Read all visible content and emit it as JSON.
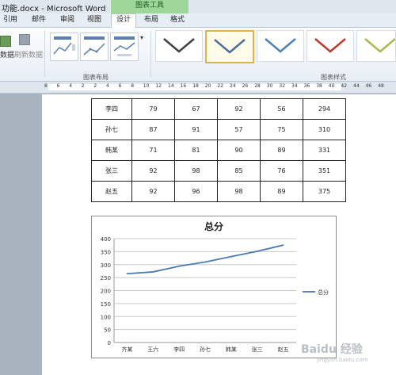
{
  "window": {
    "title": "功能.docx - Microsoft Word",
    "contextual_tools": "图表工具"
  },
  "tabs": [
    {
      "label": "引用"
    },
    {
      "label": "邮件"
    },
    {
      "label": "审阅"
    },
    {
      "label": "视图"
    },
    {
      "label": "设计",
      "active": true
    },
    {
      "label": "布局"
    },
    {
      "label": "格式"
    }
  ],
  "ribbon": {
    "data_label": "数据",
    "refresh_label": "刷新数据",
    "layout_group_label": "图表布局",
    "style_group_label": "图表样式",
    "style_colors": [
      "#404040",
      "#4b6f9c",
      "#4b82b8",
      "#c0392b",
      "#a9b84a"
    ]
  },
  "ruler": {
    "ticks": [
      "8",
      "6",
      "4",
      "2",
      "2",
      "4",
      "6",
      "8",
      "10",
      "12",
      "14",
      "16",
      "18",
      "20",
      "22",
      "24",
      "26",
      "28",
      "30",
      "32",
      "34",
      "36",
      "38",
      "40",
      "42",
      "44",
      "46",
      "48"
    ]
  },
  "table": {
    "rows": [
      {
        "name": "李四",
        "scores": [
          "79",
          "67",
          "92",
          "56",
          "294"
        ]
      },
      {
        "name": "孙七",
        "scores": [
          "87",
          "91",
          "57",
          "75",
          "310"
        ]
      },
      {
        "name": "韩某",
        "scores": [
          "71",
          "81",
          "90",
          "89",
          "331"
        ]
      },
      {
        "name": "张三",
        "scores": [
          "92",
          "98",
          "85",
          "76",
          "351"
        ]
      },
      {
        "name": "赵五",
        "scores": [
          "92",
          "96",
          "98",
          "89",
          "375"
        ]
      }
    ]
  },
  "chart_data": {
    "type": "line",
    "title": "总分",
    "categories": [
      "齐某",
      "王六",
      "李四",
      "孙七",
      "韩某",
      "张三",
      "赵五"
    ],
    "series": [
      {
        "name": "总分",
        "values": [
          265,
          272,
          294,
          310,
          331,
          351,
          375
        ],
        "color": "#4a7ab5"
      }
    ],
    "ylim": [
      0,
      400
    ],
    "yticks": [
      0,
      50,
      100,
      150,
      200,
      250,
      300,
      350,
      400
    ],
    "grid": true,
    "legend": "right"
  },
  "watermark": {
    "text": "Baidu 经验",
    "sub": "jingyan.baidu.com"
  }
}
